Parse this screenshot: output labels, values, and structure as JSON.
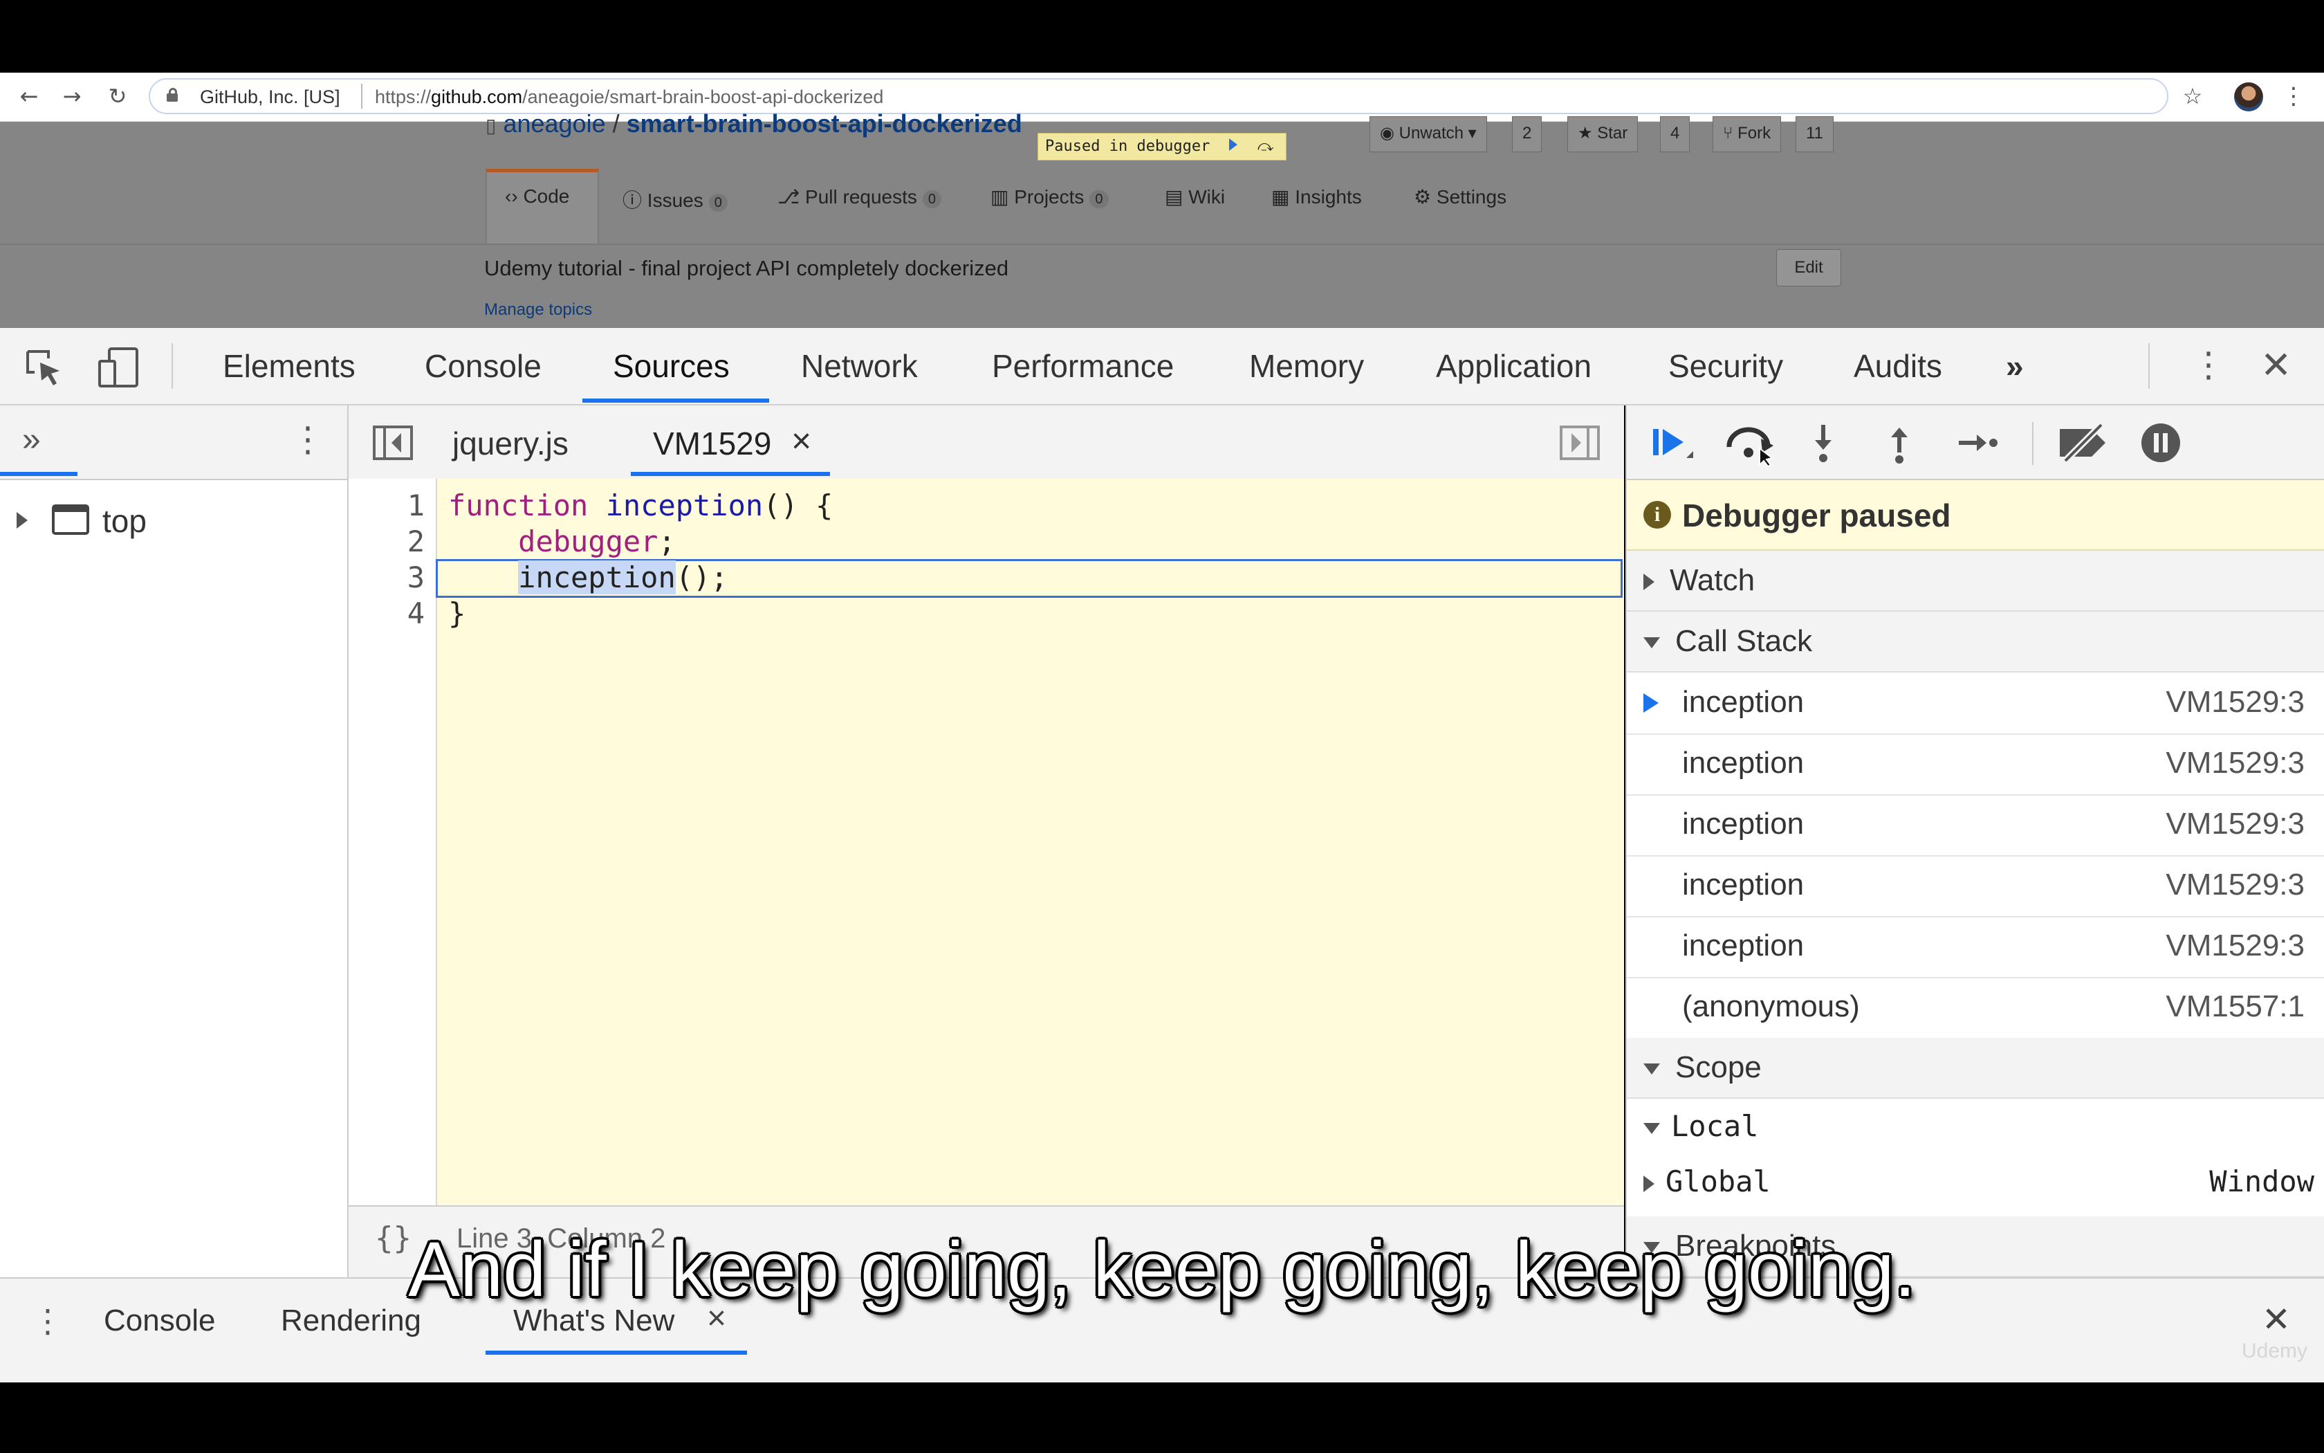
{
  "browser": {
    "site_identity": "GitHub, Inc. [US]",
    "url_prefix": "https://",
    "url_host": "github.com",
    "url_path": "/aneagoie/smart-brain-boost-api-dockerized"
  },
  "github": {
    "repo_owner": "aneagoie",
    "repo_sep": "/",
    "repo_name": "smart-brain-boost-api-dockerized",
    "paused_banner": "Paused in debugger",
    "unwatch": {
      "label": "Unwatch ▾",
      "count": "2"
    },
    "star": {
      "label": "Star",
      "count": "4"
    },
    "fork": {
      "label": "Fork",
      "count": "11"
    },
    "tabs": [
      {
        "label": "Code"
      },
      {
        "label": "Issues",
        "count": "0"
      },
      {
        "label": "Pull requests",
        "count": "0"
      },
      {
        "label": "Projects",
        "count": "0"
      },
      {
        "label": "Wiki"
      },
      {
        "label": "Insights"
      },
      {
        "label": "Settings"
      }
    ],
    "description": "Udemy tutorial - final project API completely dockerized",
    "manage_topics": "Manage topics",
    "edit": "Edit"
  },
  "devtools": {
    "tabs": [
      "Elements",
      "Console",
      "Sources",
      "Network",
      "Performance",
      "Memory",
      "Application",
      "Security",
      "Audits"
    ],
    "more_tabs": "»",
    "navigator": {
      "more": "»",
      "tree_root": "top"
    },
    "editor": {
      "files": [
        "jquery.js",
        "VM1529"
      ],
      "close": "×",
      "line_numbers": [
        "1",
        "2",
        "3",
        "4"
      ],
      "code": {
        "l1_kw": "function",
        "l1_fn": "inception",
        "l1_rest": "() {",
        "l2_kw": "debugger",
        "l2_rest": ";",
        "l3_sel": "inception",
        "l3_rest": "();",
        "l4": "}"
      },
      "status_braces": "{}",
      "status": "Line 3, Column 2"
    },
    "debugger": {
      "paused_message": "Debugger paused",
      "watch": "Watch",
      "call_stack": "Call Stack",
      "frames": [
        {
          "name": "inception",
          "location": "VM1529:3"
        },
        {
          "name": "inception",
          "location": "VM1529:3"
        },
        {
          "name": "inception",
          "location": "VM1529:3"
        },
        {
          "name": "inception",
          "location": "VM1529:3"
        },
        {
          "name": "inception",
          "location": "VM1529:3"
        },
        {
          "name": "(anonymous)",
          "location": "VM1557:1"
        }
      ],
      "scope": "Scope",
      "local": "Local",
      "global": "Global",
      "global_value": "Window",
      "breakpoints": "Breakpoints"
    },
    "drawer": {
      "tabs": [
        "Console",
        "Rendering",
        "What's New"
      ],
      "close": "×"
    }
  },
  "caption": "And if I keep going, keep going, keep going.",
  "watermark": "Udemy",
  "colors": {
    "accent": "#1a73e8",
    "paused_bg": "#fffbdb",
    "caption": "#ffffff"
  }
}
